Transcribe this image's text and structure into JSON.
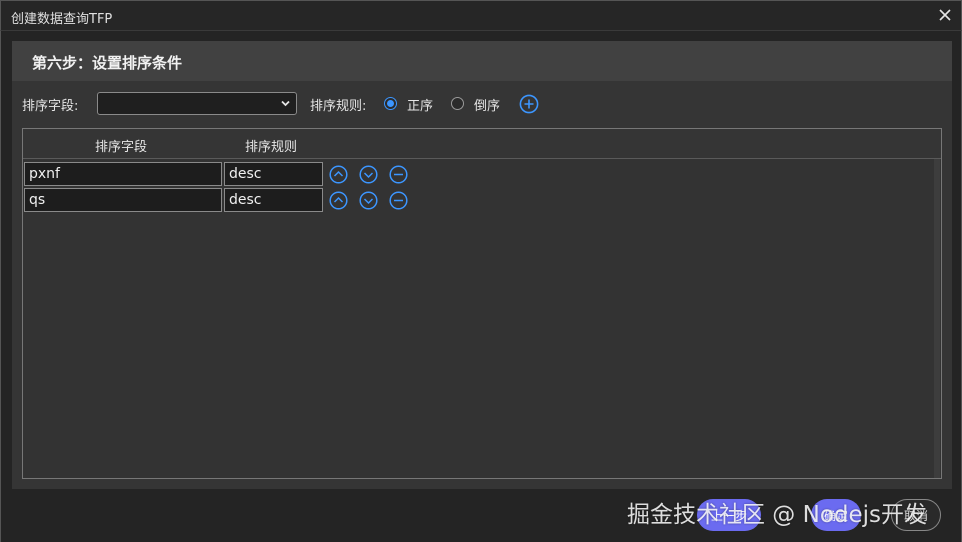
{
  "window": {
    "title": "创建数据查询TFP"
  },
  "step": {
    "title": "第六步：设置排序条件"
  },
  "toolbar": {
    "field_label": "排序字段:",
    "field_value": "",
    "rule_label": "排序规则:",
    "asc_label": "正序",
    "desc_label": "倒序",
    "selected_rule": "asc"
  },
  "table": {
    "columns": [
      "排序字段",
      "排序规则"
    ],
    "rows": [
      {
        "field": "pxnf",
        "rule": "desc"
      },
      {
        "field": "qs",
        "rule": "desc"
      }
    ]
  },
  "footer": {
    "prev_label": "上一步",
    "ok_label": "确定",
    "cancel_label": "取消"
  },
  "watermark": {
    "text": "掘金技术社区 @ Nodejs开发"
  },
  "colors": {
    "accent": "#3c96ff",
    "button": "#6b6bf0"
  },
  "icons": {
    "close": "close-icon",
    "dropdown": "chevron-down-icon",
    "add": "plus-circle-icon",
    "up": "arrow-up-circle-icon",
    "down": "arrow-down-circle-icon",
    "remove": "minus-circle-icon"
  }
}
